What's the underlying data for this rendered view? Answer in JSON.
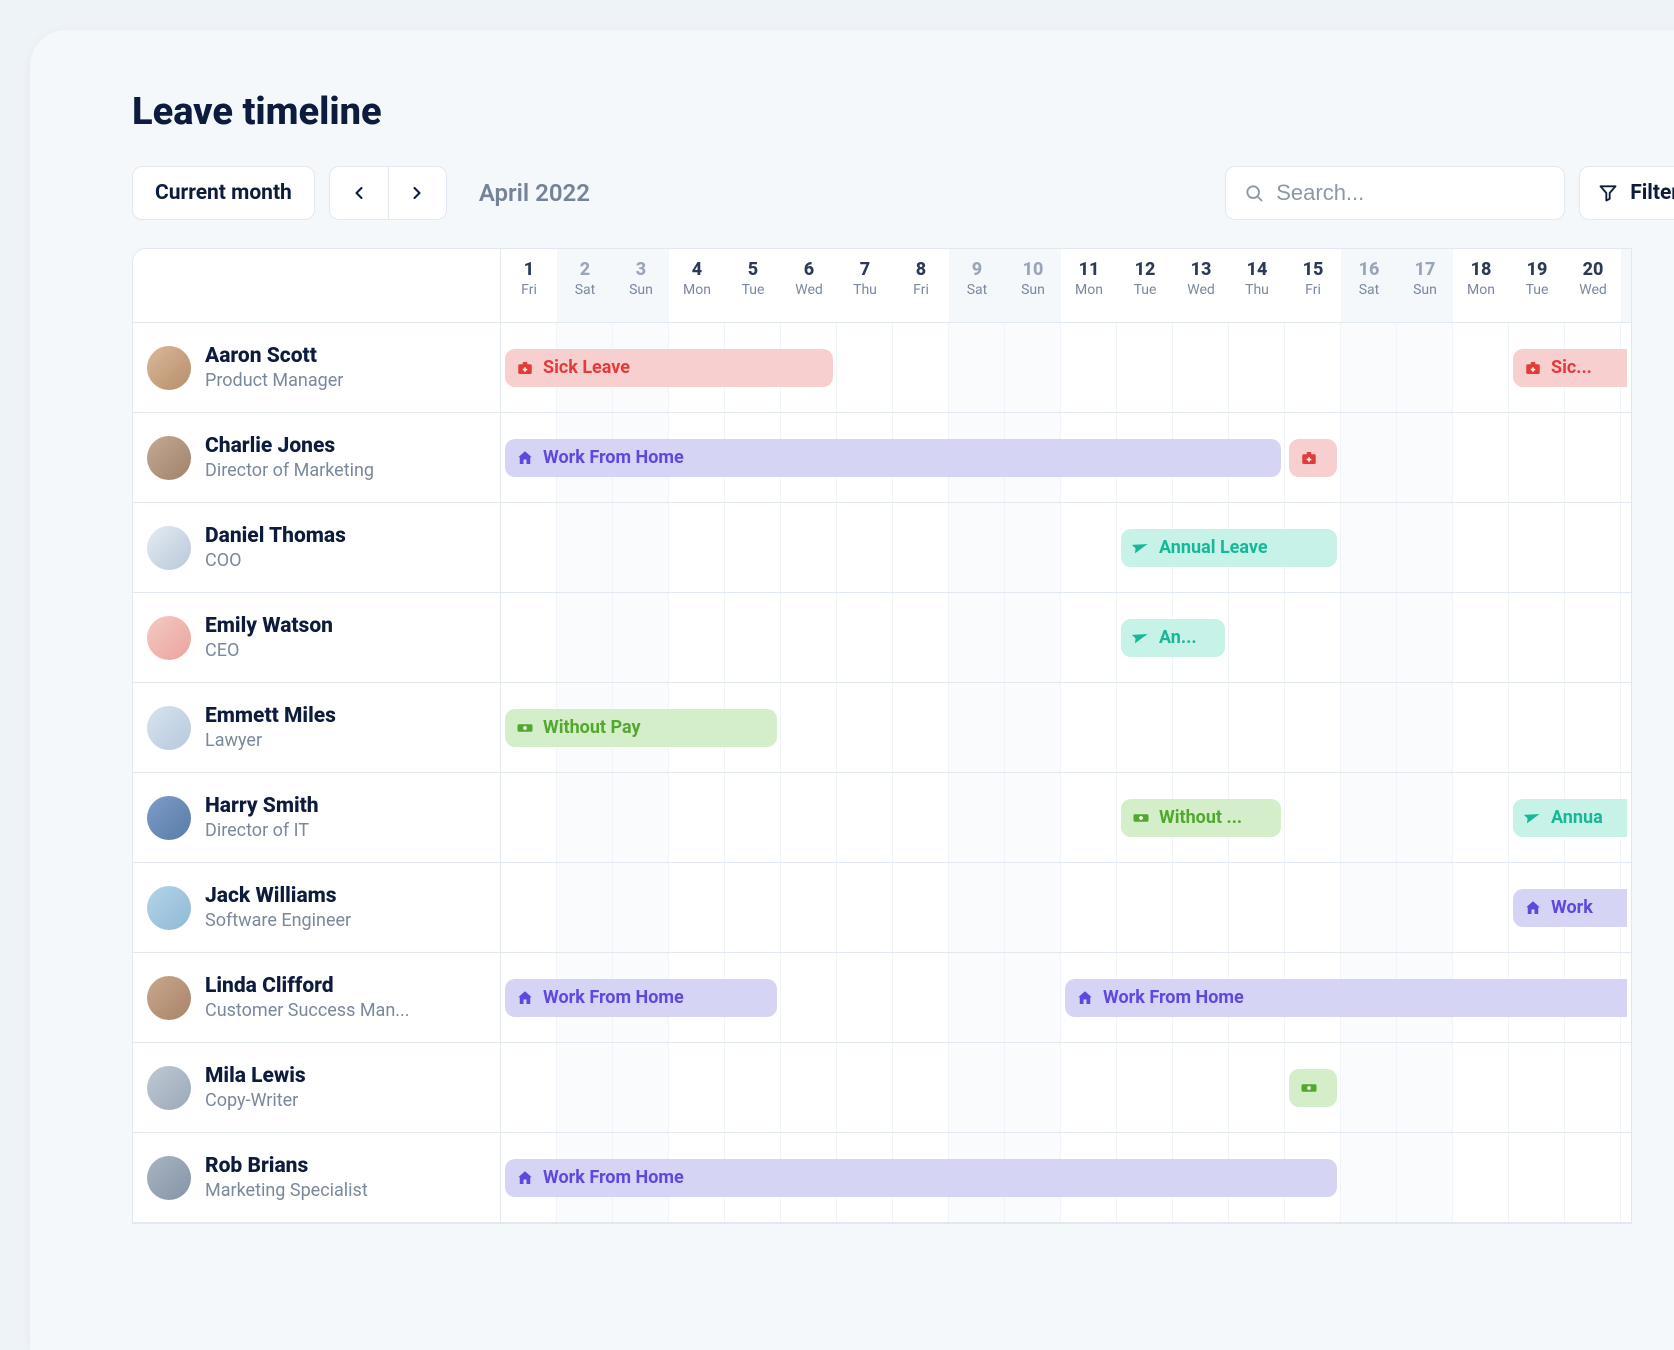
{
  "title": "Leave timeline",
  "toolbar": {
    "current_month_label": "Current month",
    "month_display": "April 2022",
    "search_placeholder": "Search...",
    "filter_label": "Filter"
  },
  "days": [
    {
      "num": "1",
      "name": "Fri",
      "weekend": false
    },
    {
      "num": "2",
      "name": "Sat",
      "weekend": true
    },
    {
      "num": "3",
      "name": "Sun",
      "weekend": true
    },
    {
      "num": "4",
      "name": "Mon",
      "weekend": false
    },
    {
      "num": "5",
      "name": "Tue",
      "weekend": false
    },
    {
      "num": "6",
      "name": "Wed",
      "weekend": false
    },
    {
      "num": "7",
      "name": "Thu",
      "weekend": false
    },
    {
      "num": "8",
      "name": "Fri",
      "weekend": false
    },
    {
      "num": "9",
      "name": "Sat",
      "weekend": true
    },
    {
      "num": "10",
      "name": "Sun",
      "weekend": true
    },
    {
      "num": "11",
      "name": "Mon",
      "weekend": false
    },
    {
      "num": "12",
      "name": "Tue",
      "weekend": false
    },
    {
      "num": "13",
      "name": "Wed",
      "weekend": false
    },
    {
      "num": "14",
      "name": "Thu",
      "weekend": false
    },
    {
      "num": "15",
      "name": "Fri",
      "weekend": false
    },
    {
      "num": "16",
      "name": "Sat",
      "weekend": true
    },
    {
      "num": "17",
      "name": "Sun",
      "weekend": true
    },
    {
      "num": "18",
      "name": "Mon",
      "weekend": false
    },
    {
      "num": "19",
      "name": "Tue",
      "weekend": false
    },
    {
      "num": "20",
      "name": "Wed",
      "weekend": false
    }
  ],
  "employees": [
    {
      "name": "Aaron Scott",
      "role": "Product Manager",
      "avatar_bg": "linear-gradient(135deg,#d9b99a,#b88d6a)",
      "events": [
        {
          "type": "sick",
          "label": "Sick Leave",
          "start": 1,
          "end": 6,
          "icon": "medkit"
        },
        {
          "type": "sick",
          "label": "Sic...",
          "start": 19,
          "end": 20,
          "icon": "medkit",
          "edge": "right"
        }
      ]
    },
    {
      "name": "Charlie Jones",
      "role": "Director of Marketing",
      "avatar_bg": "linear-gradient(135deg,#c4a992,#a0826b)",
      "events": [
        {
          "type": "wfh",
          "label": "Work From Home",
          "start": 1,
          "end": 14,
          "icon": "home"
        },
        {
          "type": "sick",
          "label": "",
          "start": 15,
          "end": 15,
          "icon": "medkit"
        }
      ]
    },
    {
      "name": "Daniel Thomas",
      "role": "COO",
      "avatar_bg": "linear-gradient(135deg,#e5ecf3,#b8c7d9)",
      "events": [
        {
          "type": "annual",
          "label": "Annual Leave",
          "start": 12,
          "end": 15,
          "icon": "plane"
        }
      ]
    },
    {
      "name": "Emily Watson",
      "role": "CEO",
      "avatar_bg": "linear-gradient(135deg,#f5c9c4,#e9a49c)",
      "events": [
        {
          "type": "annual",
          "label": "An...",
          "start": 12,
          "end": 13,
          "icon": "plane"
        }
      ]
    },
    {
      "name": "Emmett Miles",
      "role": "Lawyer",
      "avatar_bg": "linear-gradient(135deg,#d8e4ef,#b5c8dc)",
      "events": [
        {
          "type": "nopay",
          "label": "Without Pay",
          "start": 1,
          "end": 5,
          "icon": "money"
        }
      ]
    },
    {
      "name": "Harry Smith",
      "role": "Director of IT",
      "avatar_bg": "linear-gradient(135deg,#7e9dc7,#5a7ba8)",
      "events": [
        {
          "type": "nopay",
          "label": "Without ...",
          "start": 12,
          "end": 14,
          "icon": "money"
        },
        {
          "type": "annual",
          "label": "Annua",
          "start": 19,
          "end": 20,
          "icon": "plane",
          "edge": "right"
        }
      ]
    },
    {
      "name": "Jack Williams",
      "role": "Software Engineer",
      "avatar_bg": "linear-gradient(135deg,#b3d4e8,#8fb9d6)",
      "events": [
        {
          "type": "wfh",
          "label": "Work",
          "start": 19,
          "end": 20,
          "icon": "home",
          "edge": "right"
        }
      ]
    },
    {
      "name": "Linda Clifford",
      "role": "Customer Success Man...",
      "avatar_bg": "linear-gradient(135deg,#c9a88e,#a88468)",
      "events": [
        {
          "type": "wfh",
          "label": "Work From Home",
          "start": 1,
          "end": 5,
          "icon": "home"
        },
        {
          "type": "wfh",
          "label": "Work From Home",
          "start": 11,
          "end": 20,
          "icon": "home",
          "edge": "right"
        }
      ]
    },
    {
      "name": "Mila Lewis",
      "role": "Copy-Writer",
      "avatar_bg": "linear-gradient(135deg,#bfc9d4,#9aa8b8)",
      "events": [
        {
          "type": "nopay",
          "label": "",
          "start": 15,
          "end": 15,
          "icon": "money"
        }
      ]
    },
    {
      "name": "Rob Brians",
      "role": "Marketing Specialist",
      "avatar_bg": "linear-gradient(135deg,#a8b4c2,#8594a6)",
      "events": [
        {
          "type": "wfh",
          "label": "Work From Home",
          "start": 1,
          "end": 15,
          "icon": "home"
        }
      ]
    }
  ],
  "colors": {
    "sick_bg": "#f8cfcf",
    "sick_fg": "#e23b3b",
    "wfh_bg": "#d6d4f5",
    "wfh_fg": "#5b49e0",
    "annual_bg": "#c6f2e7",
    "annual_fg": "#16b89a",
    "nopay_bg": "#d4eec9",
    "nopay_fg": "#52a82f"
  }
}
